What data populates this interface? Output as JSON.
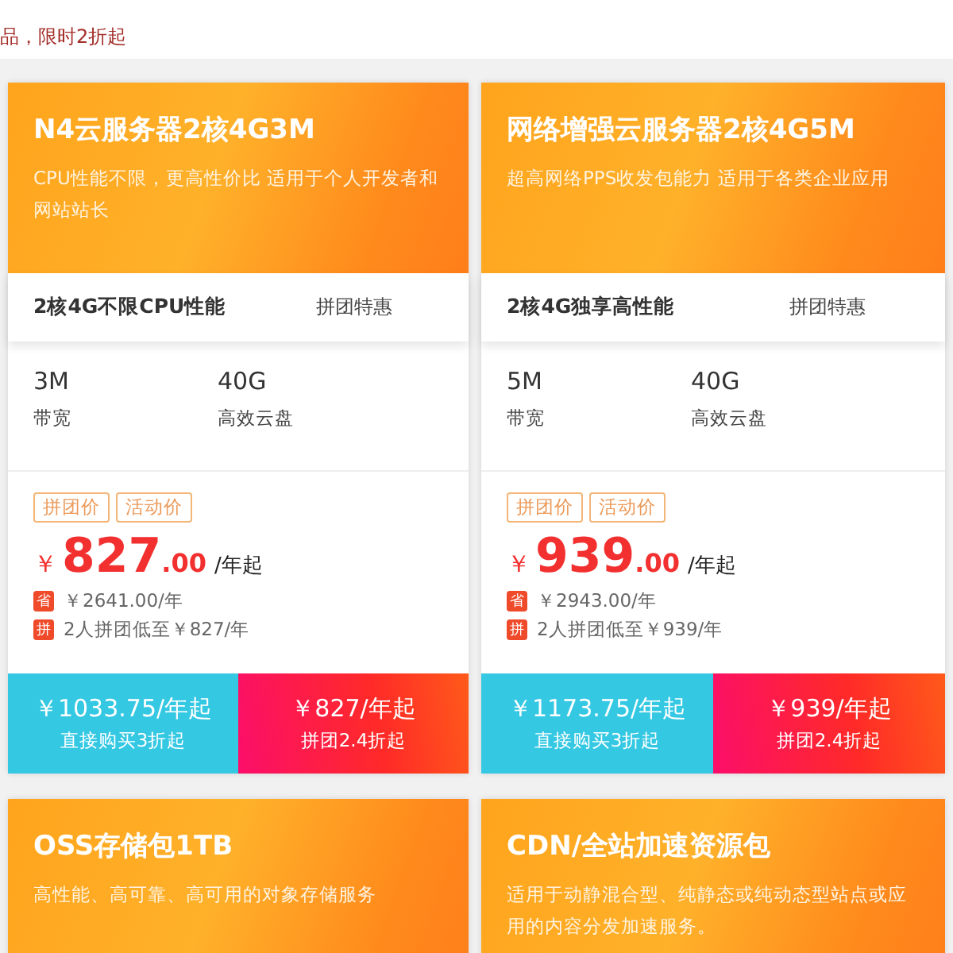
{
  "subtitle": "品，限时2折起",
  "products": [
    {
      "title": "N4云服务器2核4G3M",
      "description": "CPU性能不限，更高性价比 适用于个人开发者和网站站长",
      "feature": "2核4G不限CPU性能",
      "promo": "拼团特惠",
      "specs": [
        {
          "value": "3M",
          "label": "带宽"
        },
        {
          "value": "40G",
          "label": "高效云盘"
        }
      ],
      "tags": [
        "拼团价",
        "活动价"
      ],
      "currency": "￥",
      "price": "827",
      "cents": ".00",
      "unit": "/年起",
      "notes": [
        {
          "badge": "省",
          "text": "￥2641.00/年"
        },
        {
          "badge": "拼",
          "text": "2人拼团低至￥827/年"
        }
      ],
      "buttons": [
        {
          "kind": "direct",
          "price": "￥1033.75/年起",
          "caption": "直接购买3折起"
        },
        {
          "kind": "group",
          "price": "￥827/年起",
          "caption": "拼团2.4折起"
        }
      ]
    },
    {
      "title": "网络增强云服务器2核4G5M",
      "description": "超高网络PPS收发包能力 适用于各类企业应用",
      "feature": "2核4G独享高性能",
      "promo": "拼团特惠",
      "specs": [
        {
          "value": "5M",
          "label": "带宽"
        },
        {
          "value": "40G",
          "label": "高效云盘"
        }
      ],
      "tags": [
        "拼团价",
        "活动价"
      ],
      "currency": "￥",
      "price": "939",
      "cents": ".00",
      "unit": "/年起",
      "notes": [
        {
          "badge": "省",
          "text": "￥2943.00/年"
        },
        {
          "badge": "拼",
          "text": "2人拼团低至￥939/年"
        }
      ],
      "buttons": [
        {
          "kind": "direct",
          "price": "￥1173.75/年起",
          "caption": "直接购买3折起"
        },
        {
          "kind": "group",
          "price": "￥939/年起",
          "caption": "拼团2.4折起"
        }
      ]
    },
    {
      "title": "OSS存储包1TB",
      "description": "高性能、高可靠、高可用的对象存储服务"
    },
    {
      "title": "CDN/全站加速资源包",
      "description": "适用于动静混合型、纯静态或纯动态型站点或应用的内容分发加速服务。"
    }
  ]
}
